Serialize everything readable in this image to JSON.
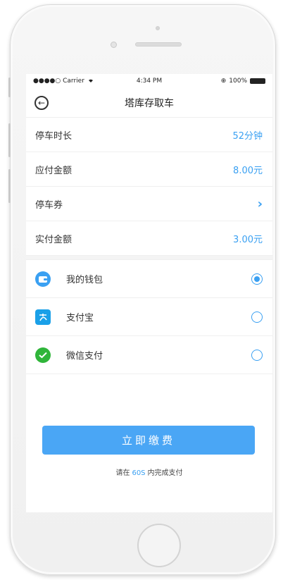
{
  "status_bar": {
    "carrier": "●●●●○ Carrier",
    "time": "4:34 PM",
    "battery": "100%"
  },
  "nav": {
    "title": "塔库存取车"
  },
  "info_rows": [
    {
      "label": "停车时长",
      "value": "52分钟"
    },
    {
      "label": "应付金额",
      "value": "8.00元"
    },
    {
      "label": "停车券",
      "value": "›"
    },
    {
      "label": "实付金额",
      "value": "3.00元"
    }
  ],
  "payment_methods": [
    {
      "label": "我的钱包",
      "icon": "wallet-icon",
      "color": "#3aa0f2",
      "selected": true
    },
    {
      "label": "支付宝",
      "icon": "alipay-icon",
      "color": "#1aa0e8",
      "selected": false
    },
    {
      "label": "微信支付",
      "icon": "wechat-pay-icon",
      "color": "#2fb53a",
      "selected": false
    }
  ],
  "pay_button": {
    "label": "立即缴费"
  },
  "timer": {
    "prefix": "请在",
    "seconds": "60S",
    "suffix": "内完成支付"
  },
  "colors": {
    "accent": "#3aa0f2",
    "button": "#4aa6f5"
  }
}
